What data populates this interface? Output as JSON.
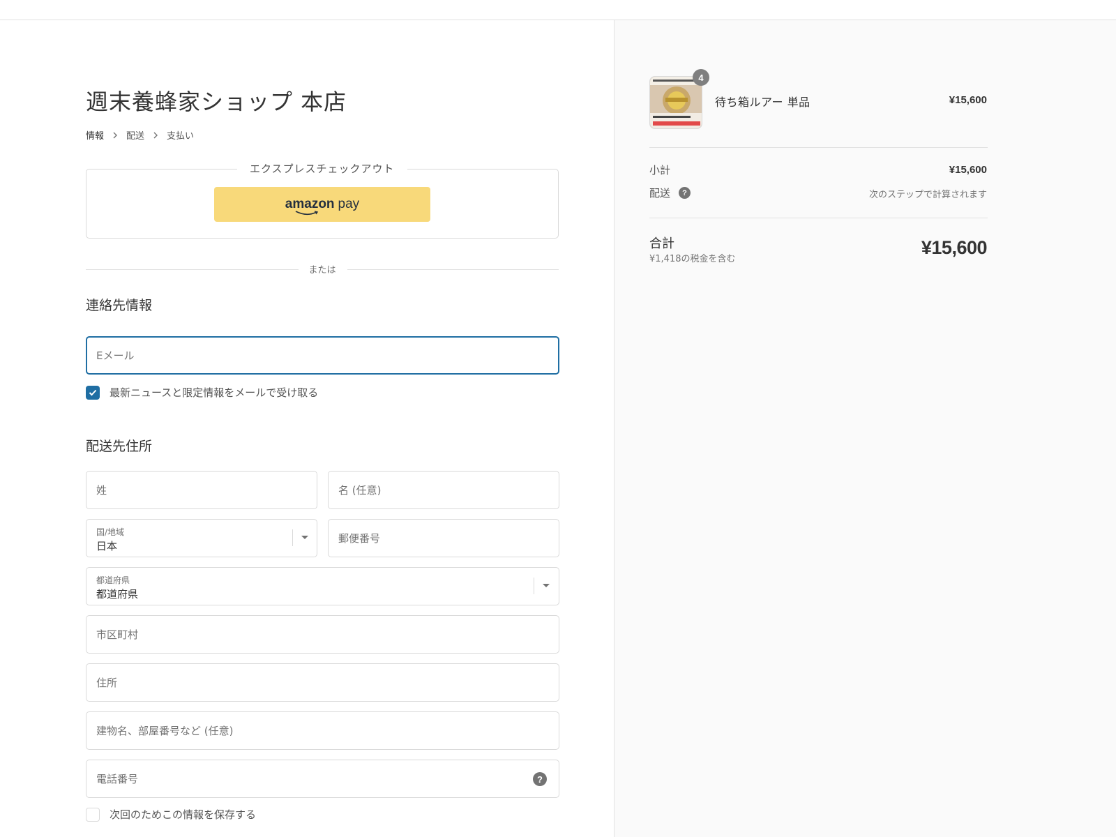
{
  "shop": {
    "title": "週末養蜂家ショップ 本店"
  },
  "breadcrumb": [
    "情報",
    "配送",
    "支払い"
  ],
  "express": {
    "legend": "エクスプレスチェックアウト",
    "amazon_bold": "amazon",
    "amazon_light": "pay",
    "button_color": "#f8d97a"
  },
  "or_text": "または",
  "contact": {
    "title": "連絡先情報",
    "email_placeholder": "Eメール",
    "newsletter_label": "最新ニュースと限定情報をメールで受け取る",
    "newsletter_checked": true
  },
  "shipping": {
    "title": "配送先住所",
    "last_name_placeholder": "姓",
    "first_name_placeholder": "名 (任意)",
    "country_label": "国/地域",
    "country_value": "日本",
    "postal_placeholder": "郵便番号",
    "prefecture_label": "都道府県",
    "prefecture_value": "都道府県",
    "city_placeholder": "市区町村",
    "address_placeholder": "住所",
    "building_placeholder": "建物名、部屋番号など (任意)",
    "phone_placeholder": "電話番号",
    "save_label": "次回のためこの情報を保存する",
    "save_checked": false
  },
  "order": {
    "item_name": "待ち箱ルアー 単品",
    "item_qty": "4",
    "item_price": "¥15,600",
    "subtotal_label": "小計",
    "subtotal_value": "¥15,600",
    "shipping_label": "配送",
    "shipping_note": "次のステップで計算されます",
    "total_label": "合計",
    "tax_note": "¥1,418の税金を含む",
    "total_value": "¥15,600"
  },
  "colors": {
    "accent": "#1f6ea3",
    "sidebar_bg": "#fafafa",
    "border": "#d9d9d9"
  }
}
